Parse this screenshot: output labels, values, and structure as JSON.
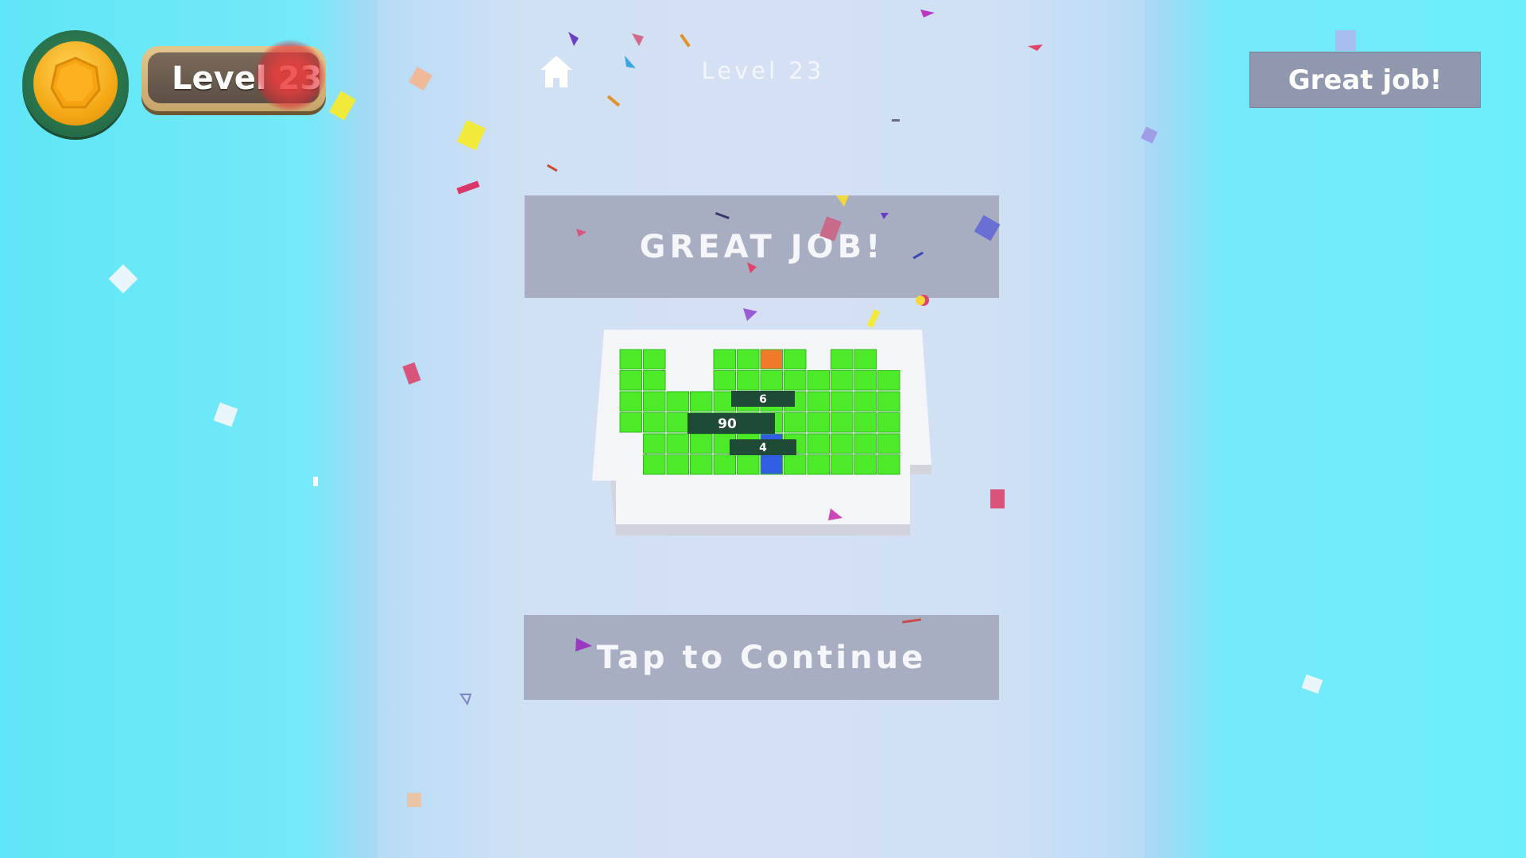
{
  "hud": {
    "coin_icon": "coin-icon",
    "level_badge": "Level 23",
    "great_job_button": "Great job!"
  },
  "top_bar": {
    "home_icon": "home-icon",
    "level_title": "Level 23"
  },
  "result": {
    "banner": "GREAT JOB!",
    "continue_button": "Tap to Continue"
  },
  "board": {
    "labels": [
      "6",
      "90",
      "4"
    ]
  },
  "colors": {
    "background_side": "#74e9f9",
    "background_center": "#d6e0f4",
    "panel": "#a8aec2",
    "tile_green": "#4dea2a",
    "tile_orange": "#f07a2a",
    "tile_blue": "#2f5fe0"
  }
}
